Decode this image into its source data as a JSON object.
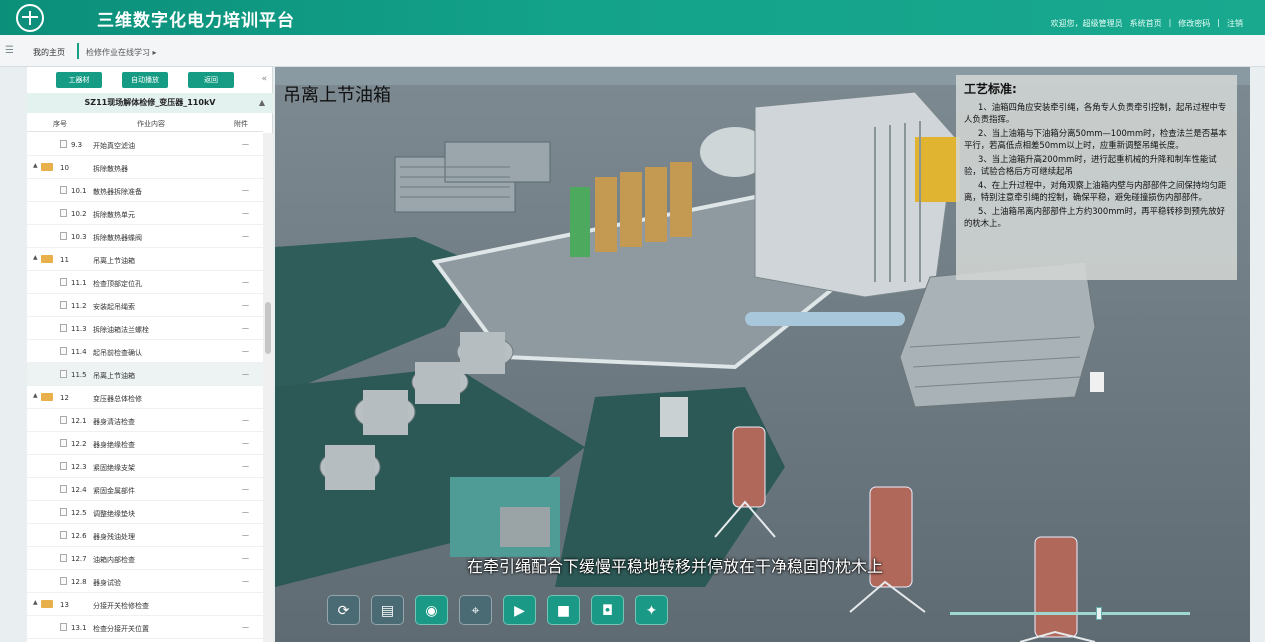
{
  "app": {
    "title": "三维数字化电力培训平台"
  },
  "header": {
    "links": [
      "欢迎您，超级管理员",
      "系统首页",
      "修改密码",
      "注销"
    ]
  },
  "breadcrumb": {
    "home": "我的主页",
    "tab": "检修作业在线学习 ▸"
  },
  "sidebar": {
    "buttons": [
      "工器材",
      "自动播放",
      "返回"
    ],
    "tree_title": "SZ11现场解体检修_变压器_110kV",
    "columns": [
      "序号",
      "作业内容",
      "附件"
    ],
    "rows": [
      {
        "num": "9.3",
        "text": "开始真空滤油",
        "att": "—",
        "level": 2
      },
      {
        "num": "10",
        "text": "拆除散热器",
        "att": "",
        "level": 1
      },
      {
        "num": "10.1",
        "text": "散热器拆除准备",
        "att": "—",
        "level": 2
      },
      {
        "num": "10.2",
        "text": "拆除散热单元",
        "att": "—",
        "level": 2
      },
      {
        "num": "10.3",
        "text": "拆除散热器蝶阀",
        "att": "—",
        "level": 2
      },
      {
        "num": "11",
        "text": "吊离上节油箱",
        "att": "",
        "level": 1
      },
      {
        "num": "11.1",
        "text": "检查顶部定位孔",
        "att": "—",
        "level": 2
      },
      {
        "num": "11.2",
        "text": "安装起吊绳索",
        "att": "—",
        "level": 2
      },
      {
        "num": "11.3",
        "text": "拆除油箱法兰螺栓",
        "att": "—",
        "level": 2
      },
      {
        "num": "11.4",
        "text": "起吊前检查确认",
        "att": "—",
        "level": 2
      },
      {
        "num": "11.5",
        "text": "吊离上节油箱",
        "att": "—",
        "level": 2,
        "selected": true
      },
      {
        "num": "12",
        "text": "变压器总体检修",
        "att": "",
        "level": 1
      },
      {
        "num": "12.1",
        "text": "器身清洁检查",
        "att": "—",
        "level": 2
      },
      {
        "num": "12.2",
        "text": "器身绝缘检查",
        "att": "—",
        "level": 2
      },
      {
        "num": "12.3",
        "text": "紧固绝缘支架",
        "att": "—",
        "level": 2
      },
      {
        "num": "12.4",
        "text": "紧固金属部件",
        "att": "—",
        "level": 2
      },
      {
        "num": "12.5",
        "text": "调整绝缘垫块",
        "att": "—",
        "level": 2
      },
      {
        "num": "12.6",
        "text": "器身残油处理",
        "att": "—",
        "level": 2
      },
      {
        "num": "12.7",
        "text": "油箱内部检查",
        "att": "—",
        "level": 2
      },
      {
        "num": "12.8",
        "text": "器身试验",
        "att": "—",
        "level": 2
      },
      {
        "num": "13",
        "text": "分接开关检修检查",
        "att": "",
        "level": 1
      },
      {
        "num": "13.1",
        "text": "检查分接开关位置",
        "att": "—",
        "level": 2
      }
    ]
  },
  "viewport": {
    "step_title": "吊离上节油箱",
    "standard_title": "工艺标准:",
    "standard_items": [
      "1、油箱四角应安装牵引绳，各角专人负责牵引控制，起吊过程中专人负责指挥。",
      "2、当上油箱与下油箱分离50mm—100mm时，检查法兰是否基本平行，若高低点相差50mm以上时，应重新调整吊绳长度。",
      "3、当上油箱升高200mm时，进行起重机械的升降和制车性能试验，试验合格后方可继续起吊",
      "4、在上升过程中，对角观察上油箱内壁与内部部件之间保持均匀距离，特别注意牵引绳的控制，确保平稳，避免碰撞损伤内部部件。",
      "5、上油箱吊离内部部件上方约300mm时，再平稳转移到预先放好的枕木上。"
    ],
    "subtitle": "在牵引绳配合下缓慢平稳地转移并停放在干净稳固的枕木上",
    "controls": [
      {
        "icon": "refresh-icon",
        "glyph": "⟳",
        "color": "#4a6b73"
      },
      {
        "icon": "caption-icon",
        "glyph": "▤",
        "color": "#4a6b73"
      },
      {
        "icon": "eye-icon",
        "glyph": "◉",
        "color": "#1a9a86"
      },
      {
        "icon": "camera-rotate-icon",
        "glyph": "⌖",
        "color": "#4a6b73"
      },
      {
        "icon": "play-icon",
        "glyph": "▶",
        "color": "#1a9a86"
      },
      {
        "icon": "stop-icon",
        "glyph": "■",
        "color": "#1a9a86"
      },
      {
        "icon": "video-camera-icon",
        "glyph": "◘",
        "color": "#1a9a86"
      },
      {
        "icon": "lightbulb-icon",
        "glyph": "✦",
        "color": "#1a9a86"
      }
    ],
    "progress": 0.62
  }
}
